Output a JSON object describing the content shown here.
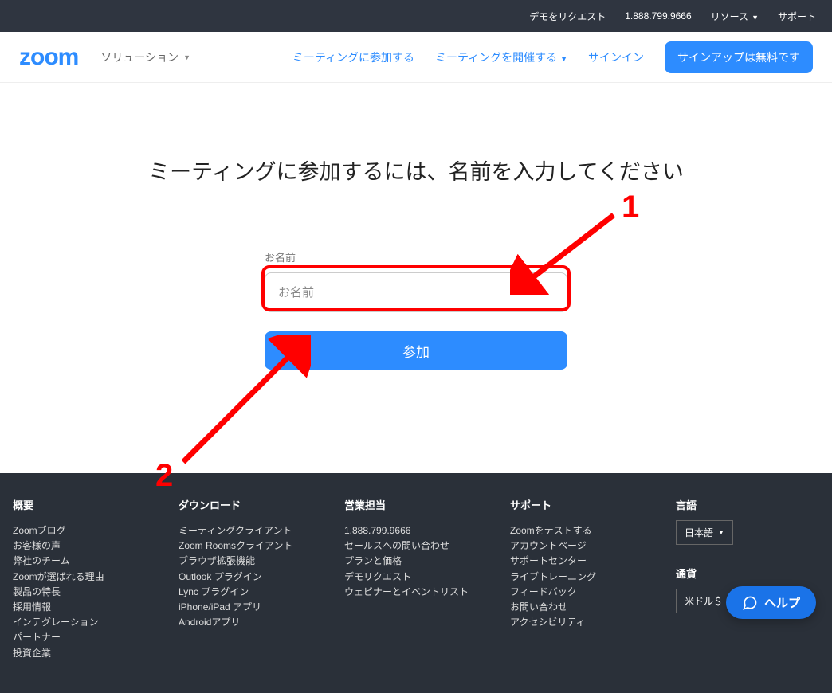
{
  "topbar": {
    "demo": "デモをリクエスト",
    "phone": "1.888.799.9666",
    "resources": "リソース",
    "support": "サポート"
  },
  "nav": {
    "logo": "zoom",
    "solutions": "ソリューション",
    "join": "ミーティングに参加する",
    "host": "ミーティングを開催する",
    "signin": "サインイン",
    "signup": "サインアップは無料です"
  },
  "main": {
    "heading": "ミーティングに参加するには、名前を入力してください",
    "name_label": "お名前",
    "name_placeholder": "お名前",
    "join_btn": "参加"
  },
  "footer": {
    "cols": [
      {
        "title": "概要",
        "links": [
          "Zoomブログ",
          "お客様の声",
          "弊社のチーム",
          "Zoomが選ばれる理由",
          "製品の特長",
          "採用情報",
          "インテグレーション",
          "パートナー",
          "投資企業"
        ]
      },
      {
        "title": "ダウンロード",
        "links": [
          "ミーティングクライアント",
          "Zoom Roomsクライアント",
          "ブラウザ拡張機能",
          "Outlook プラグイン",
          "Lync プラグイン",
          "iPhone/iPad アプリ",
          "Androidアプリ"
        ]
      },
      {
        "title": "営業担当",
        "links": [
          "1.888.799.9666",
          "セールスへの問い合わせ",
          "プランと価格",
          "デモリクエスト",
          "ウェビナーとイベントリスト"
        ]
      },
      {
        "title": "サポート",
        "links": [
          "Zoomをテストする",
          "アカウントページ",
          "サポートセンター",
          "ライブトレーニング",
          "フィードバック",
          "お問い合わせ",
          "アクセシビリティ"
        ]
      }
    ],
    "lang_label": "言語",
    "lang_value": "日本語",
    "currency_label": "通貨",
    "currency_value": "米ドル＄"
  },
  "help": {
    "label": "ヘルプ"
  },
  "annotations": {
    "one": "1",
    "two": "2"
  }
}
